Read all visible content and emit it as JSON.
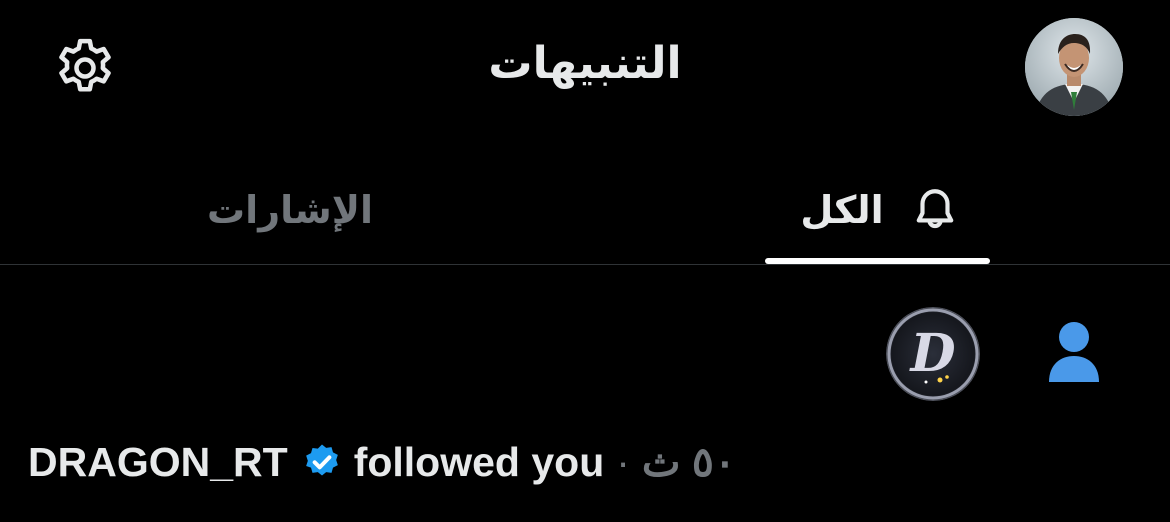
{
  "header": {
    "title": "التنبيهات",
    "settings_icon": "gear-icon",
    "avatar_icon": "profile-avatar"
  },
  "tabs": [
    {
      "label": "الكل",
      "icon": "bell-icon",
      "active": true
    },
    {
      "label": "الإشارات",
      "active": false
    }
  ],
  "notification": {
    "type_icon": "person-icon",
    "username": "DRAGON_RT",
    "verified": true,
    "action": "followed you",
    "separator": "·",
    "time": "٥٠ ث",
    "avatar_letter": "D"
  },
  "colors": {
    "background": "#000000",
    "text": "#e7e9ea",
    "muted": "#71767b",
    "accent": "#1d9bf0",
    "person_icon": "#4a99e9"
  }
}
